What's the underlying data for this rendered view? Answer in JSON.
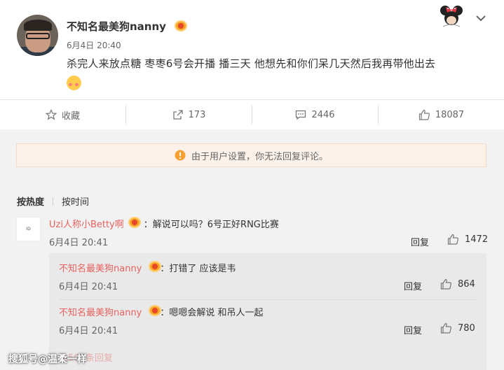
{
  "post": {
    "username": "不知名最美狗nanny",
    "time": "6月4日 20:40",
    "text": "杀完人来放点糖 枣枣6号会开播 播三天 他想先和你们呆几天然后我再带他出去"
  },
  "actions": {
    "favorite": "收藏",
    "repost": "173",
    "comments": "2446",
    "likes": "18087"
  },
  "notice": "由于用户设置，你无法回复评论。",
  "sort": {
    "hot": "按热度",
    "time": "按时间"
  },
  "comment": {
    "avatar_text": "ID",
    "name": "Uzi人称小Betty啊",
    "text": "：解说可以吗？6号正好RNG比赛",
    "time": "6月4日 20:41",
    "reply": "回复",
    "likes": "1472"
  },
  "replies": [
    {
      "name": "不知名最美狗nanny",
      "text": "：打错了 应该是韦",
      "time": "6月4日 20:41",
      "reply": "回复",
      "likes": "864"
    },
    {
      "name": "不知名最美狗nanny",
      "text": "：嗯嗯会解说 和吊人一起",
      "time": "6月4日 20:41",
      "reply": "回复",
      "likes": "780"
    }
  ],
  "faded_text": "共503条回复",
  "watermark": "搜狐号@温柔一样",
  "colors": {
    "accent_name": "#e8625f",
    "notice_bg": "#fdf2ea",
    "notice_icon": "#f7a034"
  }
}
